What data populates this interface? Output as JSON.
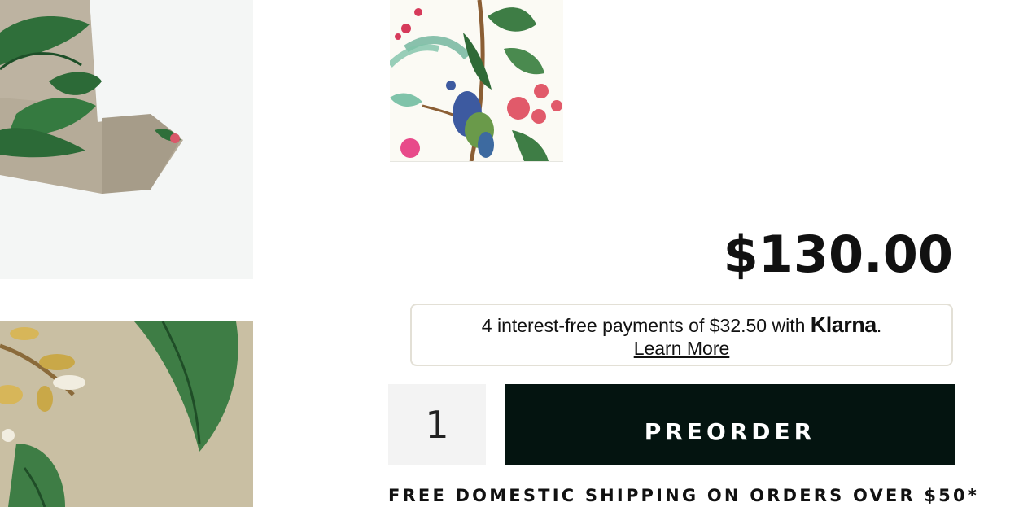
{
  "product": {
    "price": "$130.00",
    "klarna": {
      "text_before": "4 interest-free payments of $32.50 with ",
      "brand": "Klarna",
      "text_after": ".",
      "link": "Learn More"
    },
    "quantity": "1",
    "cta_label": "PREORDER",
    "shipping_note": "FREE DOMESTIC SHIPPING ON ORDERS OVER $50*"
  },
  "colors": {
    "button_bg": "#041410",
    "qty_bg": "#f3f3f3",
    "leaf_green": "#3e7d45",
    "wallpaper_tan": "#c9bfa3"
  }
}
